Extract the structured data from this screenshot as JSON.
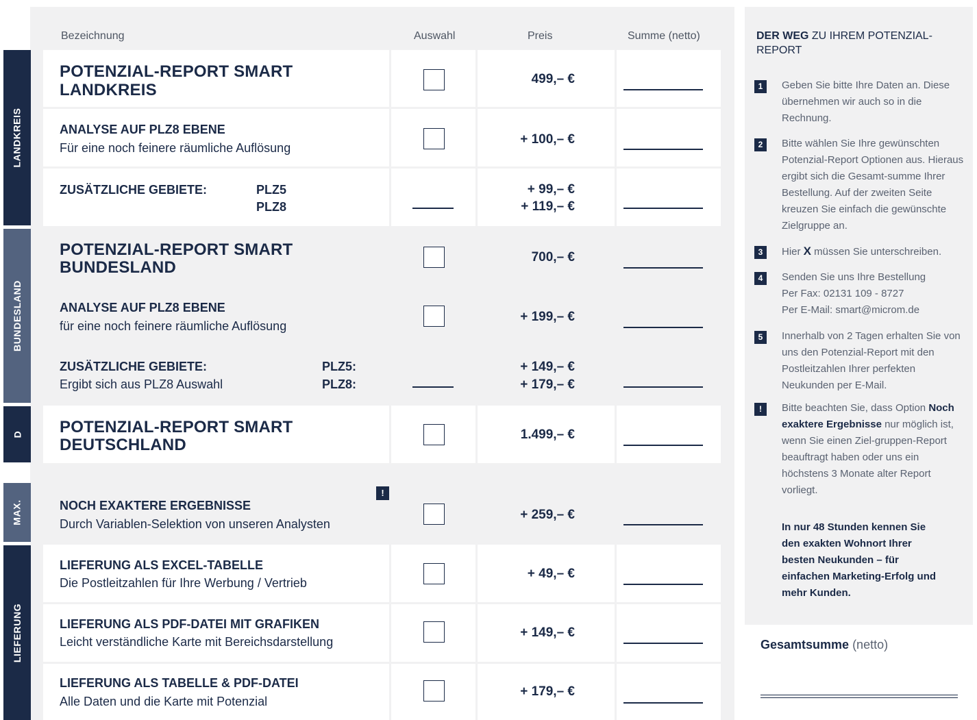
{
  "columns": {
    "description": "Bezeichnung",
    "selection": "Auswahl",
    "price": "Preis",
    "sum": "Summe (netto)"
  },
  "side_tabs": {
    "landkreis": "LANDKREIS",
    "bundesland": "BUNDESLAND",
    "d": "D",
    "max": "MAX.",
    "lieferung": "LIEFERUNG"
  },
  "rows": {
    "landkreis_main": {
      "line1": "POTENZIAL-REPORT SMART",
      "line2": "LANDKREIS",
      "price": "499,– €"
    },
    "landkreis_plz8": {
      "title": "ANALYSE AUF PLZ8 EBENE",
      "subtitle": "Für eine noch feinere räumliche Auflösung",
      "price": "+ 100,– €"
    },
    "landkreis_extra": {
      "title": "ZUSÄTZLICHE GEBIETE:",
      "plz5": "PLZ5",
      "plz8": "PLZ8",
      "price_plz5": "+ 99,– €",
      "price_plz8": "+ 119,– €"
    },
    "bundesland_main": {
      "line1": "POTENZIAL-REPORT SMART",
      "line2": "BUNDESLAND",
      "price": "700,– €"
    },
    "bundesland_plz8": {
      "title": "ANALYSE AUF PLZ8 EBENE",
      "subtitle": "für eine noch feinere räumliche Auflösung",
      "price": "+ 199,– €"
    },
    "bundesland_extra": {
      "title": "ZUSÄTZLICHE GEBIETE:",
      "subtitle": "Ergibt sich aus PLZ8 Auswahl",
      "plz5": "PLZ5:",
      "plz8": "PLZ8:",
      "price_plz5": "+ 149,– €",
      "price_plz8": "+ 179,– €"
    },
    "deutschland_main": {
      "line1": "POTENZIAL-REPORT SMART",
      "line2": "DEUTSCHLAND",
      "price": "1.499,– €"
    },
    "max_exakt": {
      "title": "NOCH EXAKTERE ERGEBNISSE",
      "subtitle": "Durch Variablen-Selektion von unseren Analysten",
      "price": "+ 259,– €",
      "badge": "!"
    },
    "lief_excel": {
      "title": "LIEFERUNG ALS EXCEL-TABELLE",
      "subtitle": "Die Postleitzahlen für Ihre Werbung / Vertrieb",
      "price": "+ 49,– €"
    },
    "lief_pdf": {
      "title": "LIEFERUNG ALS PDF-DATEI MIT GRAFIKEN",
      "subtitle": "Leicht verständliche Karte mit Bereichsdarstellung",
      "price": "+ 149,– €"
    },
    "lief_both": {
      "title": "LIEFERUNG ALS TABELLE & PDF-DATEI",
      "subtitle": "Alle Daten und die Karte mit Potenzial",
      "price": "+ 179,– €"
    }
  },
  "info": {
    "title_bold": "DER WEG",
    "title_rest": " ZU IHREM POTENZIAL-REPORT",
    "steps": [
      {
        "num": "1",
        "text": "Geben Sie bitte Ihre Daten an. Diese übernehmen wir auch so in die Rechnung."
      },
      {
        "num": "2",
        "text": "Bitte wählen Sie Ihre gewünschten Potenzial-Report Optionen aus. Hieraus ergibt sich die Gesamt-summe Ihrer Bestellung. Auf der zweiten Seite kreuzen Sie einfach die gewünschte Zielgruppe an."
      },
      {
        "num": "3",
        "text_before": "Hier ",
        "mark": "X",
        "text_after": " müssen Sie unterschreiben."
      },
      {
        "num": "4",
        "line1": "Senden Sie uns Ihre Bestellung",
        "line2": "Per Fax: 02131 109 - 8727",
        "line3": "Per E-Mail: smart@microm.de"
      },
      {
        "num": "5",
        "text": "Innerhalb von 2 Tagen erhalten Sie von uns den Potenzial-Report mit den Postleitzahlen Ihrer perfekten Neukunden per E-Mail."
      },
      {
        "num": "!",
        "text_before": "Bitte beachten Sie, dass Option ",
        "bold": "Noch exaktere Ergebnisse",
        "text_after": " nur möglich ist, wenn Sie einen Ziel-gruppen-Report beauftragt haben oder uns ein höchstens 3 Monate alter Report vorliegt."
      }
    ],
    "promo": "In nur 48 Stunden kennen Sie den exakten Wohnort Ihrer besten Neukunden – für einfachen Marketing-Erfolg und mehr Kunden."
  },
  "total": {
    "label_bold": "Gesamtsumme",
    "label_rest": " (netto)"
  },
  "colors": {
    "navy": "#1b2a47",
    "tab_mid": "#53637f",
    "panel_gray": "#f1f1f2"
  }
}
